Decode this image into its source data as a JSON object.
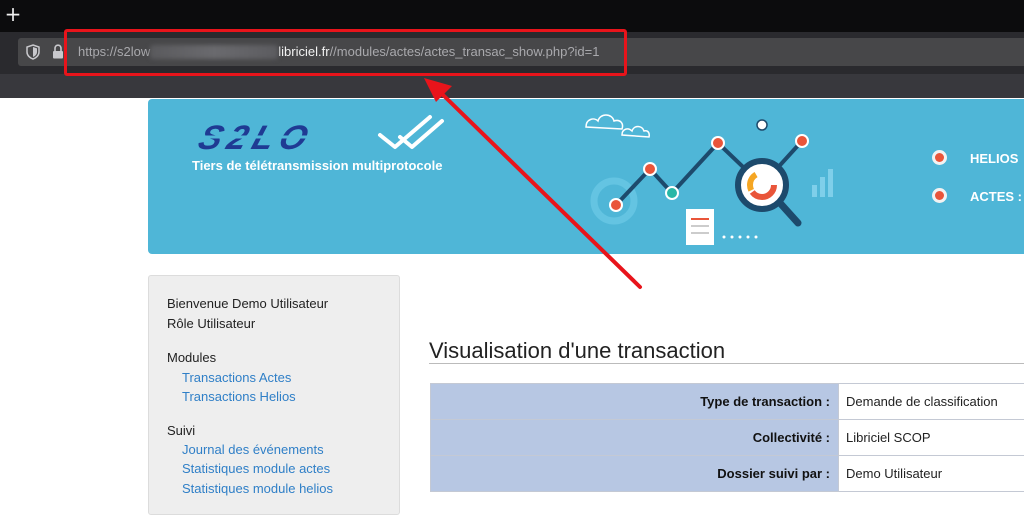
{
  "browser": {
    "new_tab": "+",
    "url": {
      "prefix": "https://s2low",
      "domain": "libriciel.fr",
      "path": "//modules/actes/actes_transac_show.php?id=1"
    }
  },
  "banner": {
    "tagline": "Tiers de télétransmission multiprotocole",
    "menu": [
      {
        "label": "HELIOS"
      },
      {
        "label": "ACTES :"
      }
    ]
  },
  "sidebar": {
    "welcome": "Bienvenue Demo Utilisateur",
    "role": "Rôle Utilisateur",
    "modules_heading": "Modules",
    "modules": [
      {
        "label": "Transactions Actes"
      },
      {
        "label": "Transactions Helios"
      }
    ],
    "suivi_heading": "Suivi",
    "suivi": [
      {
        "label": "Journal des événements"
      },
      {
        "label": "Statistiques module actes"
      },
      {
        "label": "Statistiques module helios"
      }
    ]
  },
  "main": {
    "title": "Visualisation d'une transaction",
    "rows": [
      {
        "label": "Type de transaction :",
        "value": "Demande de classification"
      },
      {
        "label": "Collectivité :",
        "value": "Libriciel SCOP"
      },
      {
        "label": "Dossier suivi par :",
        "value": "Demo Utilisateur"
      }
    ]
  },
  "colors": {
    "banner": "#4fb6d7",
    "accent": "#e9553a",
    "link": "#2f7fc7",
    "table_label_bg": "#b7c7e3",
    "annotation": "#e8141b"
  }
}
